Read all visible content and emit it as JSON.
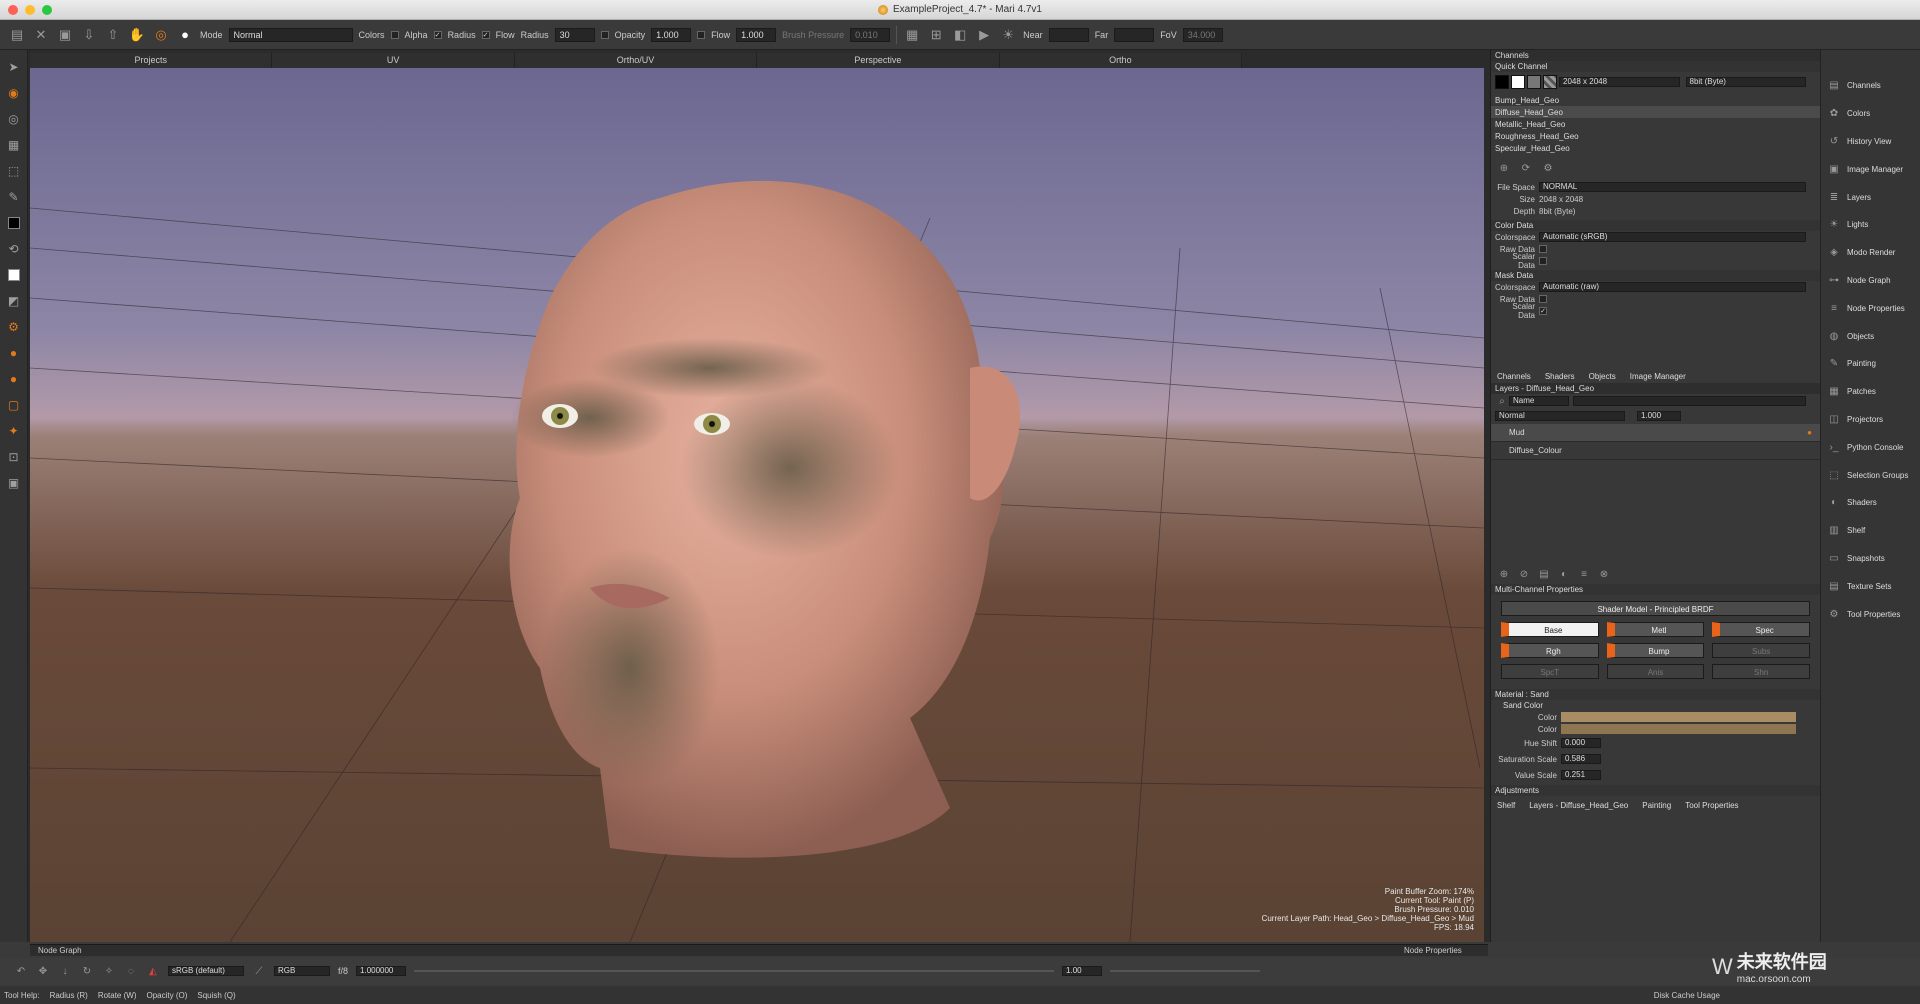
{
  "window": {
    "title": "ExampleProject_4.7* - Mari 4.7v1"
  },
  "toolbar": {
    "mode_label": "Mode",
    "mode_value": "Normal",
    "colors_label": "Colors",
    "alpha_label": "Alpha",
    "radius_check_label": "Radius",
    "flow_check_label": "Flow",
    "radius_label": "Radius",
    "radius_value": "30",
    "opacity_label": "Opacity",
    "opacity_value": "1.000",
    "flow_label": "Flow",
    "flow_value": "1.000",
    "brush_pressure_label": "Brush Pressure",
    "brush_pressure_value": "0.010",
    "near_label": "Near",
    "far_label": "Far",
    "fov_label": "FoV",
    "fov_value": "34.000"
  },
  "view_tabs": [
    "Projects",
    "UV",
    "Ortho/UV",
    "Perspective",
    "Ortho"
  ],
  "viewport_info": {
    "zoom": "Paint Buffer Zoom: 174%",
    "tool": "Current Tool: Paint (P)",
    "pressure": "Brush Pressure: 0.010",
    "path": "Current Layer Path: Head_Geo > Diffuse_Head_Geo > Mud",
    "fps": "FPS: 18.94"
  },
  "channels_panel": {
    "header": "Channels",
    "quick_channel": "Quick Channel",
    "size_value": "2048 x 2048",
    "depth_value": "8bit (Byte)",
    "channels": [
      "Bump_Head_Geo",
      "Diffuse_Head_Geo",
      "Metallic_Head_Geo",
      "Roughness_Head_Geo",
      "Specular_Head_Geo"
    ],
    "file_space_label": "File Space",
    "file_space_value": "NORMAL",
    "size_label": "Size",
    "size_info": "2048 x 2048",
    "depth_label": "Depth",
    "depth_info": "8bit (Byte)",
    "color_data_header": "Color Data",
    "colorspace_label": "Colorspace",
    "color_colorspace_value": "Automatic (sRGB)",
    "raw_data_label": "Raw Data",
    "scalar_data_label": "Scalar Data",
    "mask_data_header": "Mask Data",
    "mask_colorspace_value": "Automatic (raw)"
  },
  "mid_tabs": [
    "Channels",
    "Shaders",
    "Objects",
    "Image Manager"
  ],
  "layers_panel": {
    "header": "Layers - Diffuse_Head_Geo",
    "filter_value": "Name",
    "blend_value": "Normal",
    "opacity_value": "1.000",
    "layers": [
      "Mud",
      "Diffuse_Colour"
    ]
  },
  "multi_channel": {
    "header": "Multi-Channel Properties",
    "shader_model": "Shader Model - Principled BRDF",
    "buttons": [
      "Base",
      "Metl",
      "Spec",
      "Rgh",
      "Bump",
      "Subs",
      "SpcT",
      "Anis",
      "Shn"
    ],
    "material_header": "Material : Sand",
    "sand_color_header": "Sand Color",
    "color_label": "Color",
    "color1": "#a98c64",
    "color2": "#8f7550",
    "hue_shift_label": "Hue Shift",
    "hue_shift_value": "0.000",
    "saturation_label": "Saturation Scale",
    "saturation_value": "0.586",
    "value_label": "Value Scale",
    "value_value": "0.251",
    "adjustments_header": "Adjustments"
  },
  "bottom_panel_tabs": [
    "Shelf",
    "Layers - Diffuse_Head_Geo",
    "Painting",
    "Tool Properties"
  ],
  "sidebar": [
    "Channels",
    "Colors",
    "History View",
    "Image Manager",
    "Layers",
    "Lights",
    "Modo Render",
    "Node Graph",
    "Node Properties",
    "Objects",
    "Painting",
    "Patches",
    "Projectors",
    "Python Console",
    "Selection Groups",
    "Shaders",
    "Shelf",
    "Snapshots",
    "Texture Sets",
    "Tool Properties"
  ],
  "node_graph": {
    "label": "Node Graph",
    "properties_label": "Node Properties"
  },
  "bottom_tools": {
    "colorspace": "sRGB (default)",
    "channel": "RGB",
    "frame": "f/8",
    "gain": "1.000000",
    "zoom": "1.00"
  },
  "status": {
    "tool_help": "Tool Help:",
    "radius": "Radius (R)",
    "rotate": "Rotate (W)",
    "opacity": "Opacity (O)",
    "squish": "Squish (Q)",
    "disk_cache": "Disk Cache Usage"
  },
  "watermark": {
    "name": "未来软件园",
    "url": "mac.orsoon.com"
  }
}
